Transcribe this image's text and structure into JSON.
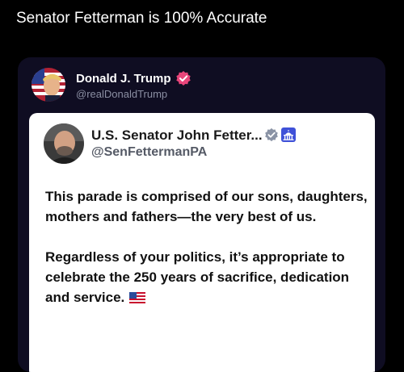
{
  "caption": "Senator Fetterman is 100% Accurate",
  "post": {
    "author": {
      "name": "Donald J. Trump",
      "handle": "@realDonaldTrump",
      "avatar_icon": "portrait-avatar",
      "verified_icon": "verified-badge-icon",
      "verified_color": "#e8457a"
    },
    "quote": {
      "author": {
        "name": "U.S. Senator John Fetter...",
        "handle": "@SenFettermanPA",
        "avatar_icon": "portrait-avatar",
        "verified_icon": "verified-badge-icon",
        "verified_color": "#8a93a5",
        "affiliation_icon": "capitol-icon",
        "affiliation_color": "#3f51d8"
      },
      "paragraphs": [
        "This parade is comprised of our sons, daughters, mothers and fathers—the very best of us.",
        "Regardless of your politics, it’s appropriate to celebrate the 250 years of sacrifice, dedication and service."
      ],
      "trailing_icon": "us-flag-icon"
    }
  },
  "colors": {
    "background": "#000000",
    "card_background": "#0f0d22",
    "quote_background": "#ffffff",
    "handle_text": "#8b8fa3"
  }
}
